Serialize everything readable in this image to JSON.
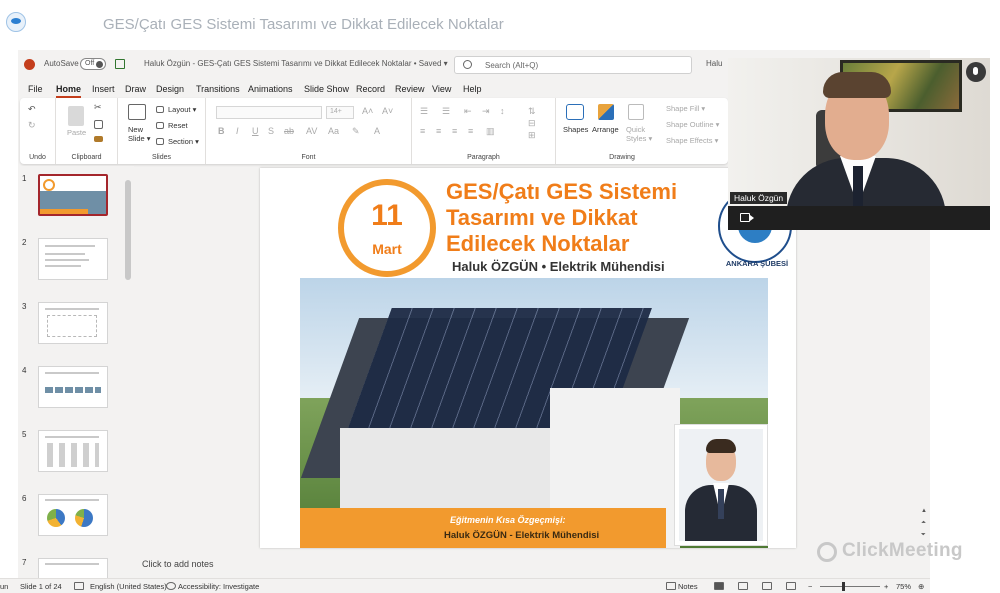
{
  "meeting": {
    "title": "GES/Çatı GES Sistemi Tasarımı ve Dikkat Edilecek Noktalar"
  },
  "ppt_titlebar": {
    "autosave": "AutoSave",
    "toggle_state": "Off",
    "document_title": "Haluk Özgün - GES-Çatı GES Sistemi Tasarımı ve Dikkat Edilecek Noktalar • Saved ▾",
    "search_placeholder": "Search (Alt+Q)",
    "user": "Halu"
  },
  "menu": [
    "File",
    "Home",
    "Insert",
    "Draw",
    "Design",
    "Transitions",
    "Animations",
    "Slide Show",
    "Record",
    "Review",
    "View",
    "Help"
  ],
  "menu_active": "Home",
  "ribbon": {
    "groups": [
      "Undo",
      "Clipboard",
      "Slides",
      "Font",
      "Paragraph",
      "Drawing"
    ],
    "paste": "Paste",
    "new_slide": "New\nSlide ▾",
    "layout": "Layout ▾",
    "reset": "Reset",
    "section": "Section ▾",
    "font_size": "14+",
    "shapes": "Shapes",
    "arrange": "Arrange",
    "quick_styles": "Quick\nStyles ▾",
    "shape_fill": "Shape Fill ▾",
    "shape_outline": "Shape Outline ▾",
    "shape_effects": "Shape Effects ▾"
  },
  "thumbnails": [
    "1",
    "2",
    "3",
    "4",
    "5",
    "6",
    "7"
  ],
  "selected_thumbnail": 1,
  "slide": {
    "day": "11",
    "month": "Mart",
    "title_lines": [
      "GES/Çatı GES Sistemi",
      "Tasarımı ve Dikkat",
      "Edilecek Noktalar"
    ],
    "subtitle": "Haluk ÖZGÜN • Elektrik Mühendisi",
    "emblem_caption": "ANKARA ŞUBESİ",
    "bio_label": "Eğitmenin Kısa Özgeçmişi:",
    "bio_name": "Haluk ÖZGÜN - Elektrik Mühendisi"
  },
  "notes": {
    "placeholder": "Click to add notes"
  },
  "status": {
    "left_cut": "un",
    "slide_of": "Slide 1 of 24",
    "language": "English (United States)",
    "accessibility": "Accessibility: Investigate",
    "notes": "Notes",
    "zoom": "75%"
  },
  "webcam": {
    "participant": "Haluk Özgün"
  },
  "watermark": "ClickMeeting",
  "colors": {
    "accent_orange": "#f07d19",
    "ppt_red": "#c43e1c",
    "thumb_select": "#a4262c"
  }
}
